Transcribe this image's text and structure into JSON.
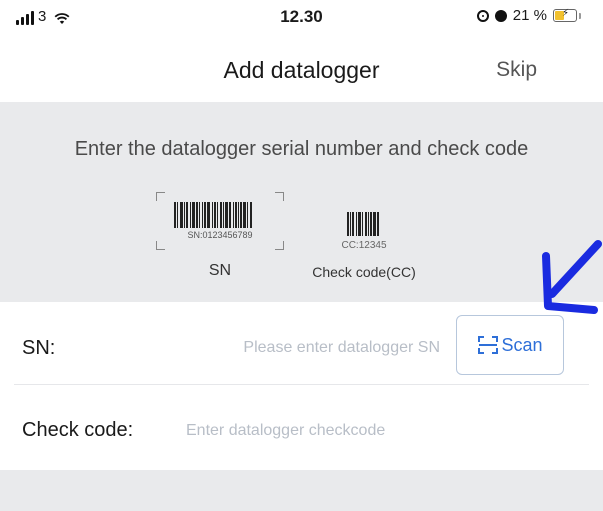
{
  "status_bar": {
    "carrier": "3",
    "time": "12.30",
    "battery_percent": "21 %",
    "icons": [
      "signal-icon",
      "wifi-icon",
      "screen-lock-icon",
      "alarm-icon",
      "battery-charging-icon"
    ]
  },
  "nav": {
    "title": "Add datalogger",
    "skip_label": "Skip"
  },
  "instructions": {
    "text": "Enter the datalogger serial number and check code",
    "sn_example_code": "SN:0123456789",
    "sn_caption": "SN",
    "cc_example_code": "CC:12345",
    "cc_caption": "Check code(CC)"
  },
  "form": {
    "sn_label": "SN:",
    "sn_value": "",
    "sn_placeholder": "Please enter datalogger SN",
    "scan_label": "Scan",
    "check_code_label": "Check code:",
    "check_code_value": "",
    "check_code_placeholder": "Enter datalogger checkcode"
  },
  "colors": {
    "accent": "#2e6fd8",
    "panel_bg": "#e9eaec",
    "annotation": "#1a2be0"
  }
}
